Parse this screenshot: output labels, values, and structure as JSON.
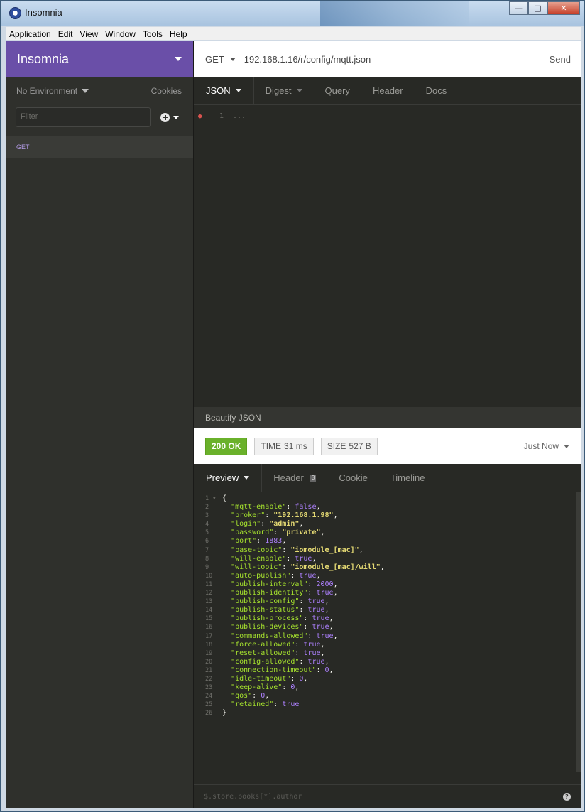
{
  "window": {
    "title": "Insomnia –"
  },
  "menu": [
    "Application",
    "Edit",
    "View",
    "Window",
    "Tools",
    "Help"
  ],
  "sidebar": {
    "workspace": "Insomnia",
    "environment": "No Environment",
    "cookies": "Cookies",
    "filter_placeholder": "Filter",
    "request_method": "GET"
  },
  "request": {
    "method": "GET",
    "url": "192.168.1.16/r/config/mqtt.json",
    "send": "Send",
    "tabs": [
      "JSON",
      "Digest",
      "Query",
      "Header",
      "Docs"
    ],
    "editor_line": "1",
    "editor_folded": "...",
    "beautify": "Beautify JSON"
  },
  "response": {
    "status": "200 OK",
    "time_label": "TIME",
    "time_value": "31 ms",
    "size_label": "SIZE",
    "size_value": "527 B",
    "when": "Just Now",
    "tabs": [
      "Preview",
      "Header",
      "Cookie",
      "Timeline"
    ],
    "header_count": "3",
    "filter_placeholder": "$.store.books[*].author",
    "body": [
      {
        "k": "mqtt-enable",
        "v": "false",
        "t": "b"
      },
      {
        "k": "broker",
        "v": "\"192.168.1.98\"",
        "t": "s"
      },
      {
        "k": "login",
        "v": "\"admin\"",
        "t": "s"
      },
      {
        "k": "password",
        "v": "\"private\"",
        "t": "s"
      },
      {
        "k": "port",
        "v": "1883",
        "t": "n"
      },
      {
        "k": "base-topic",
        "v": "\"iomodule_[mac]\"",
        "t": "s"
      },
      {
        "k": "will-enable",
        "v": "true",
        "t": "b"
      },
      {
        "k": "will-topic",
        "v": "\"iomodule_[mac]/will\"",
        "t": "s"
      },
      {
        "k": "auto-publish",
        "v": "true",
        "t": "b"
      },
      {
        "k": "publish-interval",
        "v": "2000",
        "t": "n"
      },
      {
        "k": "publish-identity",
        "v": "true",
        "t": "b"
      },
      {
        "k": "publish-config",
        "v": "true",
        "t": "b"
      },
      {
        "k": "publish-status",
        "v": "true",
        "t": "b"
      },
      {
        "k": "publish-process",
        "v": "true",
        "t": "b"
      },
      {
        "k": "publish-devices",
        "v": "true",
        "t": "b"
      },
      {
        "k": "commands-allowed",
        "v": "true",
        "t": "b"
      },
      {
        "k": "force-allowed",
        "v": "true",
        "t": "b"
      },
      {
        "k": "reset-allowed",
        "v": "true",
        "t": "b"
      },
      {
        "k": "config-allowed",
        "v": "true",
        "t": "b"
      },
      {
        "k": "connection-timeout",
        "v": "0",
        "t": "n"
      },
      {
        "k": "idle-timeout",
        "v": "0",
        "t": "n"
      },
      {
        "k": "keep-alive",
        "v": "0",
        "t": "n"
      },
      {
        "k": "qos",
        "v": "0",
        "t": "n"
      },
      {
        "k": "retained",
        "v": "true",
        "t": "b"
      }
    ]
  }
}
